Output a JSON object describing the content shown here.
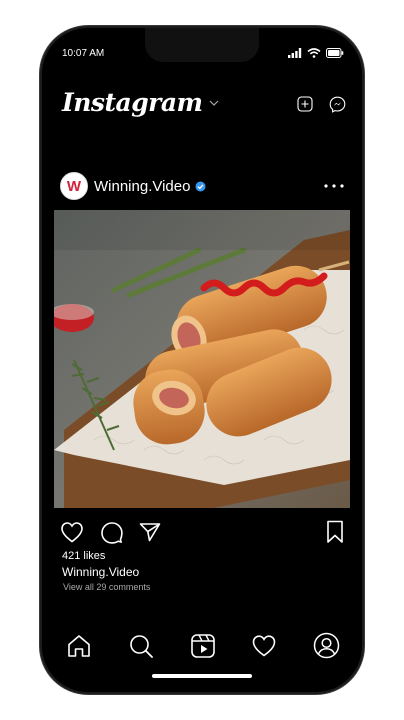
{
  "status_bar": {
    "time": "10:07 AM"
  },
  "header": {
    "logo": "Instagram"
  },
  "post": {
    "username": "Winning.Video",
    "avatar_letter": "W",
    "likes": "421 likes",
    "caption_username": "Winning.Video",
    "comments_link": "View all 29 comments"
  },
  "icons": {
    "status": [
      "signal-icon",
      "wifi-icon",
      "battery-icon"
    ],
    "header": [
      "chevron-down-icon",
      "new-post-icon",
      "messenger-icon"
    ],
    "post": [
      "verified-badge-icon",
      "more-options-icon"
    ],
    "actions": [
      "like-icon",
      "comment-icon",
      "share-icon",
      "bookmark-icon"
    ],
    "tabbar": [
      "home-icon",
      "search-icon",
      "reels-icon",
      "activity-icon",
      "profile-icon"
    ]
  },
  "colors": {
    "background": "#000000",
    "verified": "#3897f0",
    "avatar_brand": "#d3223b",
    "muted_text": "#a8a8a8"
  }
}
